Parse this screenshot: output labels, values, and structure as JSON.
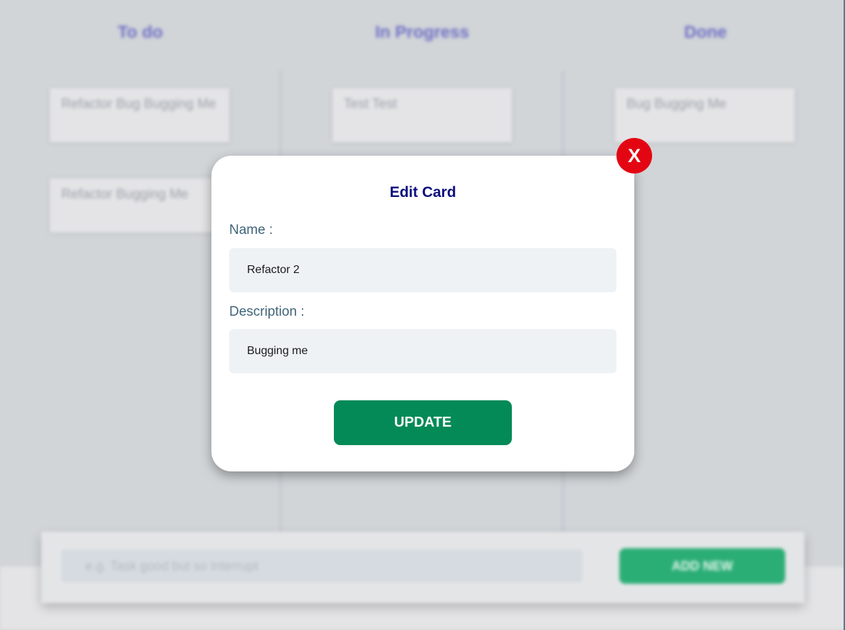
{
  "board": {
    "columns": [
      {
        "title": "To do",
        "cards": [
          "Refactor Bug Bugging Me",
          "Refactor Bugging Me"
        ]
      },
      {
        "title": "In Progress",
        "cards": [
          "Test Test"
        ]
      },
      {
        "title": "Done",
        "cards": [
          "Bug Bugging Me"
        ]
      }
    ],
    "add_bar": {
      "placeholder": "e.g. Task good but so Interrupt",
      "button_label": "ADD NEW"
    }
  },
  "modal": {
    "title": "Edit Card",
    "name_label": "Name :",
    "name_value": "Refactor 2",
    "description_label": "Description :",
    "description_value": "Bugging me",
    "update_label": "UPDATE",
    "close_label": "X"
  },
  "colors": {
    "title": "#0b0f7c",
    "update_button": "#038a57",
    "close_button": "#e30612",
    "label": "#3f6479"
  }
}
